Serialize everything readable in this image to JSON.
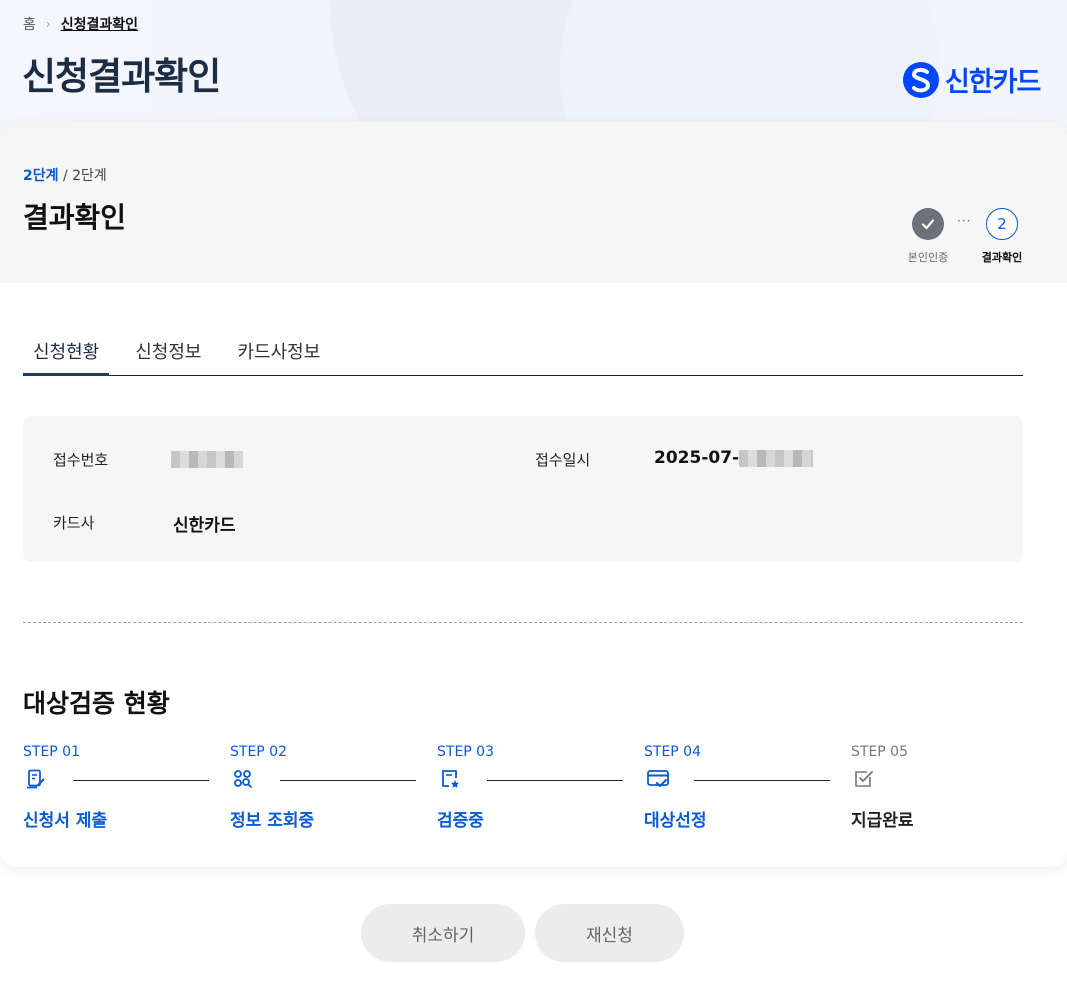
{
  "header": {
    "breadcrumb": {
      "home": "홈",
      "current": "신청결과확인"
    },
    "title": "신청결과확인",
    "logo": {
      "text": "신한카드",
      "icon": "shinhan-logo-icon",
      "color": "#0046ff"
    }
  },
  "step_indicator": {
    "current": "2단계",
    "total": "/ 2단계",
    "title": "결과확인",
    "steps": [
      {
        "label": "본인인증",
        "status": "done",
        "icon": "check-icon"
      },
      {
        "label": "결과확인",
        "number": "2",
        "status": "current"
      }
    ],
    "dots": "···"
  },
  "tabs": [
    {
      "label": "신청현황",
      "active": true
    },
    {
      "label": "신청정보",
      "active": false
    },
    {
      "label": "카드사정보",
      "active": false
    }
  ],
  "info": {
    "receipt_no_label": "접수번호",
    "receipt_date_label": "접수일시",
    "receipt_date_prefix": "2025-07-",
    "card_company_label": "카드사",
    "card_company_value": "신한카드"
  },
  "verification": {
    "title": "대상검증 현황",
    "steps": [
      {
        "no": "STEP 01",
        "name": "신청서 제출",
        "icon": "document-edit-icon",
        "status": "active"
      },
      {
        "no": "STEP 02",
        "name": "정보 조회중",
        "icon": "search-people-icon",
        "status": "active"
      },
      {
        "no": "STEP 03",
        "name": "검증중",
        "icon": "document-star-icon",
        "status": "active"
      },
      {
        "no": "STEP 04",
        "name": "대상선정",
        "icon": "card-check-icon",
        "status": "active"
      },
      {
        "no": "STEP 05",
        "name": "지급완료",
        "icon": "checkbox-icon",
        "status": "inactive"
      }
    ]
  },
  "buttons": {
    "cancel": "취소하기",
    "reapply": "재신청"
  },
  "colors": {
    "accent": "#0a5bd0",
    "title": "#1c2c44",
    "brand": "#0046ff"
  }
}
